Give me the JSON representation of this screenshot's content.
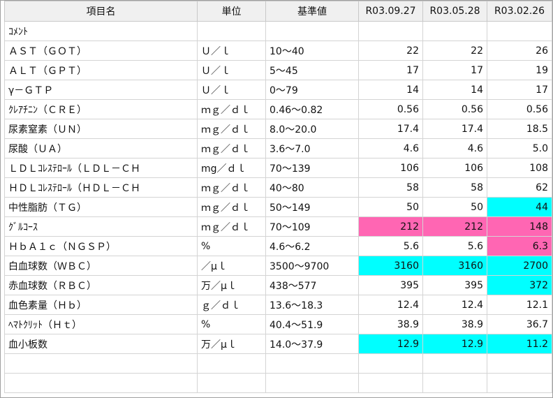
{
  "columns": {
    "name": "項目名",
    "unit": "単位",
    "ref": "基準値",
    "d1": "R03.09.27",
    "d2": "R03.05.28",
    "d3": "R03.02.26"
  },
  "colors": {
    "high_flag": "#ff66b3",
    "low_flag": "#00ffff"
  },
  "rows": [
    {
      "name": "ｺﾒﾝﾄ",
      "unit": "",
      "ref": "",
      "v1": "",
      "v2": "",
      "v3": "",
      "f1": "",
      "f2": "",
      "f3": ""
    },
    {
      "name": "ＡＳＴ（ＧＯＴ）",
      "unit": "Ｕ／ｌ",
      "ref": "10～40",
      "v1": "22",
      "v2": "22",
      "v3": "26",
      "f1": "",
      "f2": "",
      "f3": ""
    },
    {
      "name": "ＡＬＴ（ＧＰＴ）",
      "unit": "Ｕ／ｌ",
      "ref": "5～45",
      "v1": "17",
      "v2": "17",
      "v3": "19",
      "f1": "",
      "f2": "",
      "f3": ""
    },
    {
      "name": "γ－ＧＴＰ",
      "unit": "Ｕ／ｌ",
      "ref": "0～79",
      "v1": "14",
      "v2": "14",
      "v3": "17",
      "f1": "",
      "f2": "",
      "f3": ""
    },
    {
      "name": "ｸﾚｱﾁﾆﾝ（ＣＲＥ）",
      "unit": "ｍｇ／ｄｌ",
      "ref": "0.46～0.82",
      "v1": "0.56",
      "v2": "0.56",
      "v3": "0.56",
      "f1": "",
      "f2": "",
      "f3": ""
    },
    {
      "name": "尿素窒素（ＵＮ）",
      "unit": "ｍｇ／ｄｌ",
      "ref": "8.0～20.0",
      "v1": "17.4",
      "v2": "17.4",
      "v3": "18.5",
      "f1": "",
      "f2": "",
      "f3": ""
    },
    {
      "name": "尿酸（ＵＡ）",
      "unit": "ｍｇ／ｄｌ",
      "ref": "3.6～7.0",
      "v1": "4.6",
      "v2": "4.6",
      "v3": "5.0",
      "f1": "",
      "f2": "",
      "f3": ""
    },
    {
      "name": "ＬＤＬｺﾚｽﾃﾛｰﾙ（ＬＤＬ－ＣＨ",
      "unit": "mg／ｄｌ",
      "ref": "70～139",
      "v1": "106",
      "v2": "106",
      "v3": "108",
      "f1": "",
      "f2": "",
      "f3": ""
    },
    {
      "name": "ＨＤＬｺﾚｽﾃﾛｰﾙ（ＨＤＬ－ＣＨ",
      "unit": "ｍｇ／ｄｌ",
      "ref": "40～80",
      "v1": "58",
      "v2": "58",
      "v3": "62",
      "f1": "",
      "f2": "",
      "f3": ""
    },
    {
      "name": "中性脂肪（ＴＧ）",
      "unit": "ｍｇ／ｄｌ",
      "ref": "50～149",
      "v1": "50",
      "v2": "50",
      "v3": "44",
      "f1": "",
      "f2": "",
      "f3": "lo"
    },
    {
      "name": "ｸﾞﾙｺｰｽ",
      "unit": "ｍｇ／ｄｌ",
      "ref": "70～109",
      "v1": "212",
      "v2": "212",
      "v3": "148",
      "f1": "hi",
      "f2": "hi",
      "f3": "hi"
    },
    {
      "name": "ＨｂＡ１ｃ（ＮＧＳＰ）",
      "unit": "%",
      "ref": "4.6～6.2",
      "v1": "5.6",
      "v2": "5.6",
      "v3": "6.3",
      "f1": "",
      "f2": "",
      "f3": "hi"
    },
    {
      "name": "白血球数（ＷＢＣ）",
      "unit": "／μｌ",
      "ref": "3500～9700",
      "v1": "3160",
      "v2": "3160",
      "v3": "2700",
      "f1": "lo",
      "f2": "lo",
      "f3": "lo"
    },
    {
      "name": "赤血球数（ＲＢＣ）",
      "unit": "万／μｌ",
      "ref": "438～577",
      "v1": "395",
      "v2": "395",
      "v3": "372",
      "f1": "",
      "f2": "",
      "f3": "lo"
    },
    {
      "name": "血色素量（Ｈｂ）",
      "unit": "ｇ／ｄｌ",
      "ref": "13.6～18.3",
      "v1": "12.4",
      "v2": "12.4",
      "v3": "12.1",
      "f1": "",
      "f2": "",
      "f3": ""
    },
    {
      "name": "ﾍﾏﾄｸﾘｯﾄ（Ｈｔ）",
      "unit": "%",
      "ref": "40.4～51.9",
      "v1": "38.9",
      "v2": "38.9",
      "v3": "36.7",
      "f1": "",
      "f2": "",
      "f3": ""
    },
    {
      "name": "血小板数",
      "unit": "万／μｌ",
      "ref": "14.0～37.9",
      "v1": "12.9",
      "v2": "12.9",
      "v3": "11.2",
      "f1": "lo",
      "f2": "lo",
      "f3": "lo"
    }
  ]
}
